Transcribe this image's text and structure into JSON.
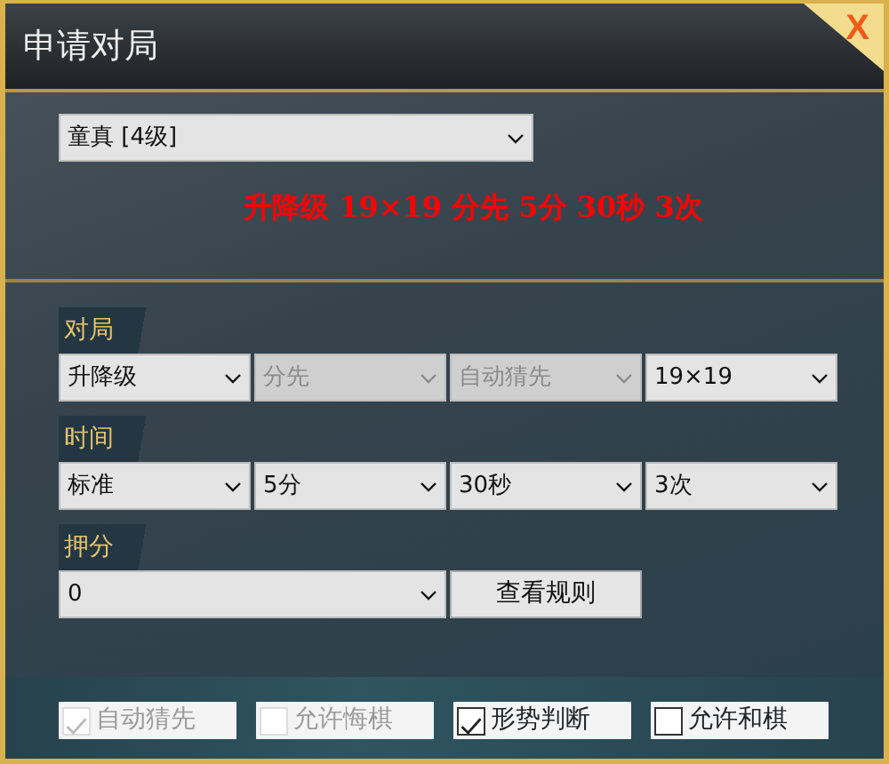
{
  "window": {
    "title": "申请对局",
    "close": "X"
  },
  "opponent": {
    "value": "童真 [4级]"
  },
  "summary": "升降级 19×19 分先 5分 30秒 3次",
  "sections": [
    {
      "label": "对局",
      "selects": [
        {
          "value": "升降级",
          "disabled": false
        },
        {
          "value": "分先",
          "disabled": true
        },
        {
          "value": "自动猜先",
          "disabled": true
        },
        {
          "value": "19×19",
          "disabled": false
        }
      ]
    },
    {
      "label": "时间",
      "selects": [
        {
          "value": "标准",
          "disabled": false
        },
        {
          "value": "5分",
          "disabled": false
        },
        {
          "value": "30秒",
          "disabled": false
        },
        {
          "value": "3次",
          "disabled": false
        }
      ]
    }
  ],
  "stake": {
    "label": "押分",
    "value": "0",
    "button": "查看规则"
  },
  "options": [
    {
      "label": "自动猜先",
      "checked": true,
      "disabled": true
    },
    {
      "label": "允许悔棋",
      "checked": false,
      "disabled": true
    },
    {
      "label": "形势判断",
      "checked": true,
      "disabled": false
    },
    {
      "label": "允许和棋",
      "checked": false,
      "disabled": false
    }
  ]
}
